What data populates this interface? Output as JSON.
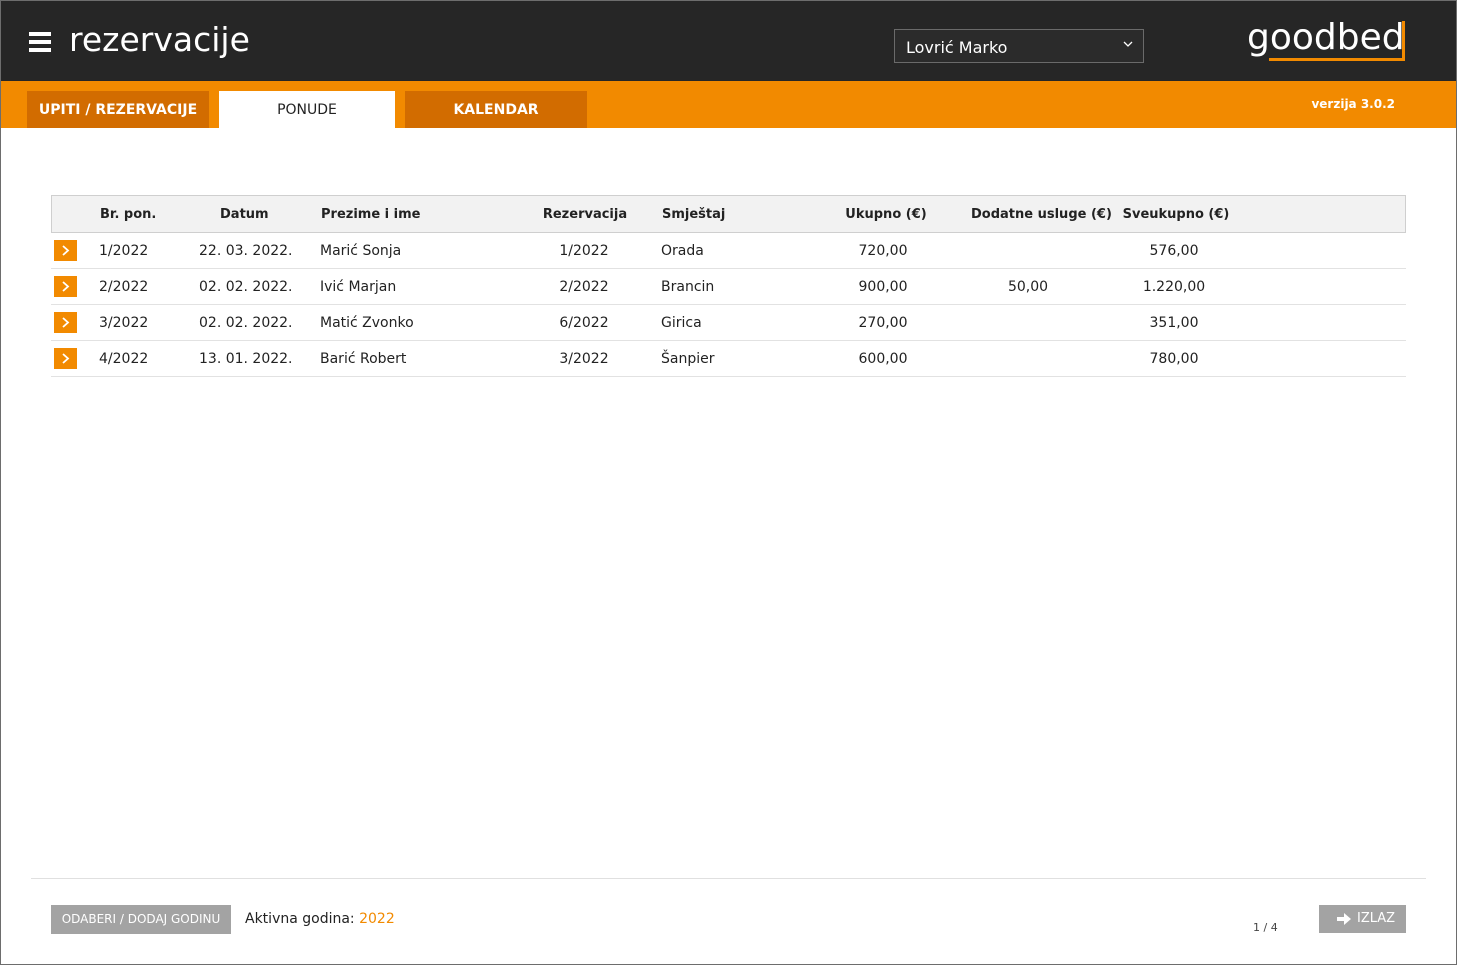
{
  "header": {
    "title": "rezervacije",
    "user_selected": "Lovrić Marko",
    "logo": "goodbed"
  },
  "tabs": [
    {
      "label": "UPITI / REZERVACIJE",
      "active": false
    },
    {
      "label": "PONUDE",
      "active": true
    },
    {
      "label": "KALENDAR",
      "active": false
    }
  ],
  "version": "verzija 3.0.2",
  "table": {
    "columns": [
      "Br. pon.",
      "Datum",
      "Prezime i ime",
      "Rezervacija",
      "Smještaj",
      "Ukupno (€)",
      "Dodatne usluge (€)",
      "Sveukupno (€)"
    ],
    "rows": [
      {
        "num": "1/2022",
        "date": "22. 03. 2022.",
        "name": "Marić Sonja",
        "reservation": "1/2022",
        "accommodation": "Orada",
        "total": "720,00",
        "additional": "",
        "grand_total": "576,00"
      },
      {
        "num": "2/2022",
        "date": "02. 02. 2022.",
        "name": "Ivić Marjan",
        "reservation": "2/2022",
        "accommodation": "Brancin",
        "total": "900,00",
        "additional": "50,00",
        "grand_total": "1.220,00"
      },
      {
        "num": "3/2022",
        "date": "02. 02. 2022.",
        "name": "Matić Zvonko",
        "reservation": "6/2022",
        "accommodation": "Girica",
        "total": "270,00",
        "additional": "",
        "grand_total": "351,00"
      },
      {
        "num": "4/2022",
        "date": "13. 01. 2022.",
        "name": "Barić Robert",
        "reservation": "3/2022",
        "accommodation": "Šanpier",
        "total": "600,00",
        "additional": "",
        "grand_total": "780,00"
      }
    ]
  },
  "footer": {
    "select_year_label": "ODABERI / DODAJ GODINU",
    "active_year_label": "Aktivna godina:",
    "active_year": "2022",
    "pager": "1 / 4",
    "exit_label": "IZLAZ"
  },
  "colors": {
    "accent": "#f28a00",
    "header_bg": "#262626",
    "tab_inactive": "#d26c00",
    "button_gray": "#a3a3a3"
  },
  "icons": {
    "menu": "hamburger-icon",
    "dropdown": "chevron-down-icon",
    "row_open": "chevron-right-icon",
    "exit": "arrow-right-icon"
  }
}
